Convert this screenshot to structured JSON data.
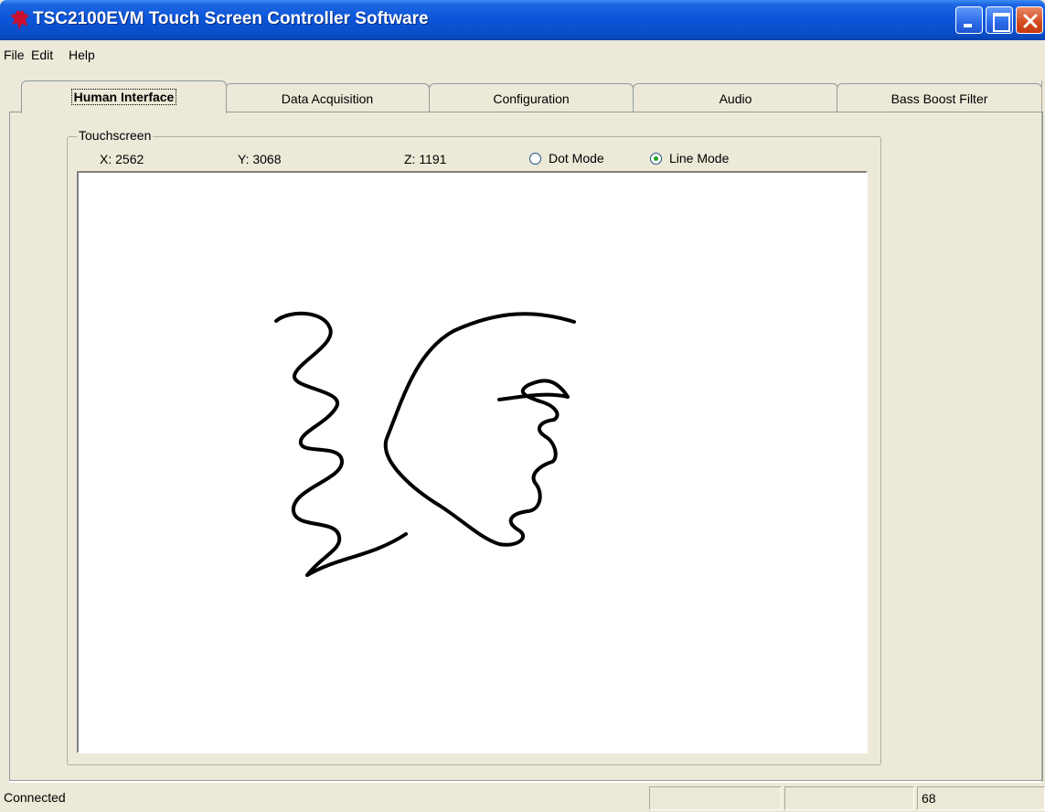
{
  "window": {
    "title": "TSC2100EVM Touch Screen Controller Software",
    "app_icon": "ti-logo-icon",
    "controls": [
      "minimize-icon",
      "maximize-icon",
      "close-icon"
    ]
  },
  "menu": {
    "file": "File",
    "edit": "Edit",
    "help": "Help"
  },
  "tabs": {
    "human_interface": "Human Interface",
    "data_acquisition": "Data Acquisition",
    "configuration": "Configuration",
    "audio": "Audio",
    "bass_boost": "Bass Boost Filter",
    "active": "Human Interface"
  },
  "touchscreen": {
    "group_label": "Touchscreen",
    "x": "X: 2562",
    "y": "Y: 3068",
    "z": "Z: 1191",
    "dot_mode": "Dot Mode",
    "line_mode": "Line Mode",
    "selected_mode": "Line Mode"
  },
  "status": {
    "connection": "Connected",
    "pane2": "",
    "pane3": "",
    "value": "68"
  },
  "colors": {
    "title_bar": "#0a54d8",
    "window_bg": "#ece9d8",
    "close_button": "#d34a1e",
    "stroke": "#000000"
  }
}
